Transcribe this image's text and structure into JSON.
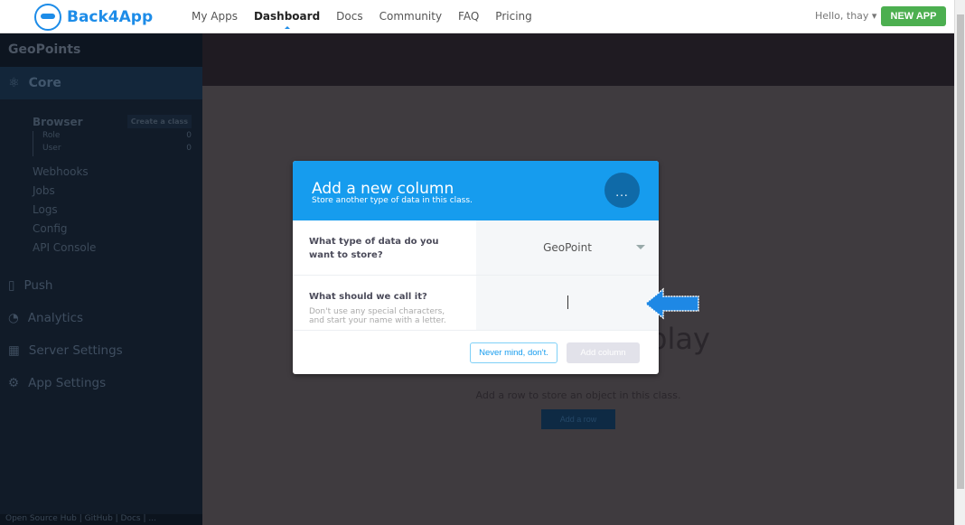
{
  "nav": {
    "brand": "Back4App",
    "items": [
      "My Apps",
      "Dashboard",
      "Docs",
      "Community",
      "FAQ",
      "Pricing"
    ],
    "active": "Dashboard",
    "greeting": "Hello, thay",
    "new_app": "NEW APP"
  },
  "sidebar": {
    "app_name": "GeoPoints",
    "core": "Core",
    "browser": "Browser",
    "create_class": "Create a class",
    "classes": [
      {
        "name": "Role",
        "count": "0"
      },
      {
        "name": "User",
        "count": "0"
      }
    ],
    "core_items": [
      "Webhooks",
      "Jobs",
      "Logs",
      "Config",
      "API Console"
    ],
    "sections": [
      "Push",
      "Analytics",
      "Server Settings",
      "App Settings"
    ],
    "footer": "Open Source Hub  |  GitHub  |  Docs  |  ..."
  },
  "main": {
    "empty_title": "No data to display",
    "empty_sub": "Add a row to store an object in this class.",
    "add_row": "Add a row"
  },
  "modal": {
    "title": "Add a new column",
    "subtitle": "Store another type of data in this class.",
    "dots": "...",
    "type_label": "What type of data do you want to store?",
    "type_value": "GeoPoint",
    "name_label": "What should we call it?",
    "name_help": "Don't use any special characters, and start your name with a letter.",
    "name_value": "",
    "cancel": "Never mind, don't.",
    "submit": "Add column"
  },
  "colors": {
    "accent": "#169cee",
    "new_app": "#4caf50",
    "arrow": "#1e88e5"
  }
}
